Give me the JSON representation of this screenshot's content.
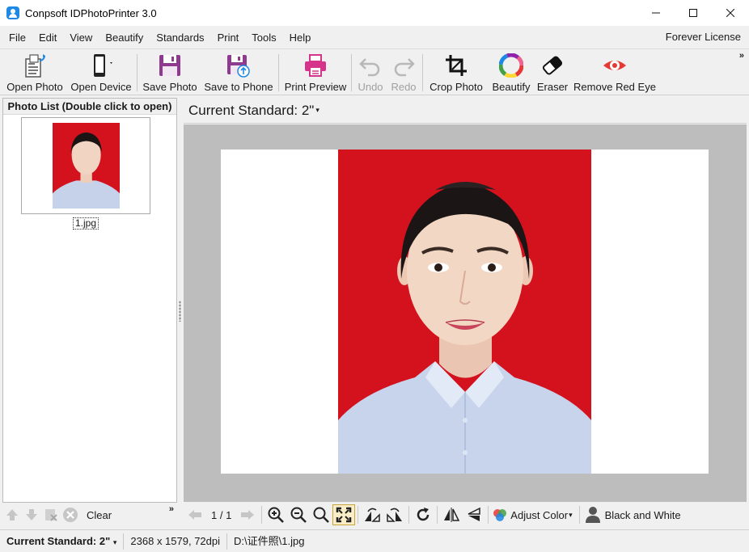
{
  "window": {
    "title": "Conpsoft IDPhotoPrinter 3.0",
    "minimize_glyph": "—",
    "maximize_glyph": "☐",
    "close_glyph": "✕"
  },
  "menu": {
    "items": [
      "File",
      "Edit",
      "View",
      "Beautify",
      "Standards",
      "Print",
      "Tools",
      "Help"
    ],
    "license": "Forever License"
  },
  "toolbar": {
    "open_photo": "Open Photo",
    "open_device": "Open Device",
    "save_photo": "Save Photo",
    "save_to_phone": "Save to Phone",
    "print_preview": "Print Preview",
    "undo": "Undo",
    "redo": "Redo",
    "crop_photo": "Crop Photo",
    "beautify": "Beautify",
    "eraser": "Eraser",
    "remove_red_eye": "Remove Red Eye",
    "overflow": "»"
  },
  "photo_list": {
    "header": "Photo List (Double click to open)",
    "items": [
      {
        "name": "1.jpg"
      }
    ],
    "clear_label": "Clear",
    "overflow": "»"
  },
  "standard": {
    "current_label": "Current Standard: 2\"",
    "caret": "▾"
  },
  "navigation": {
    "page_indicator": "1 / 1",
    "adjust_color": "Adjust Color",
    "black_and_white": "Black and White"
  },
  "statusbar": {
    "standard": "Current Standard: 2\"",
    "image_info": "2368 x 1579, 72dpi",
    "file_path": "D:\\证件照\\1.jpg"
  },
  "colors": {
    "photo_background": "#d4121e",
    "accent": "#1e88e5"
  }
}
